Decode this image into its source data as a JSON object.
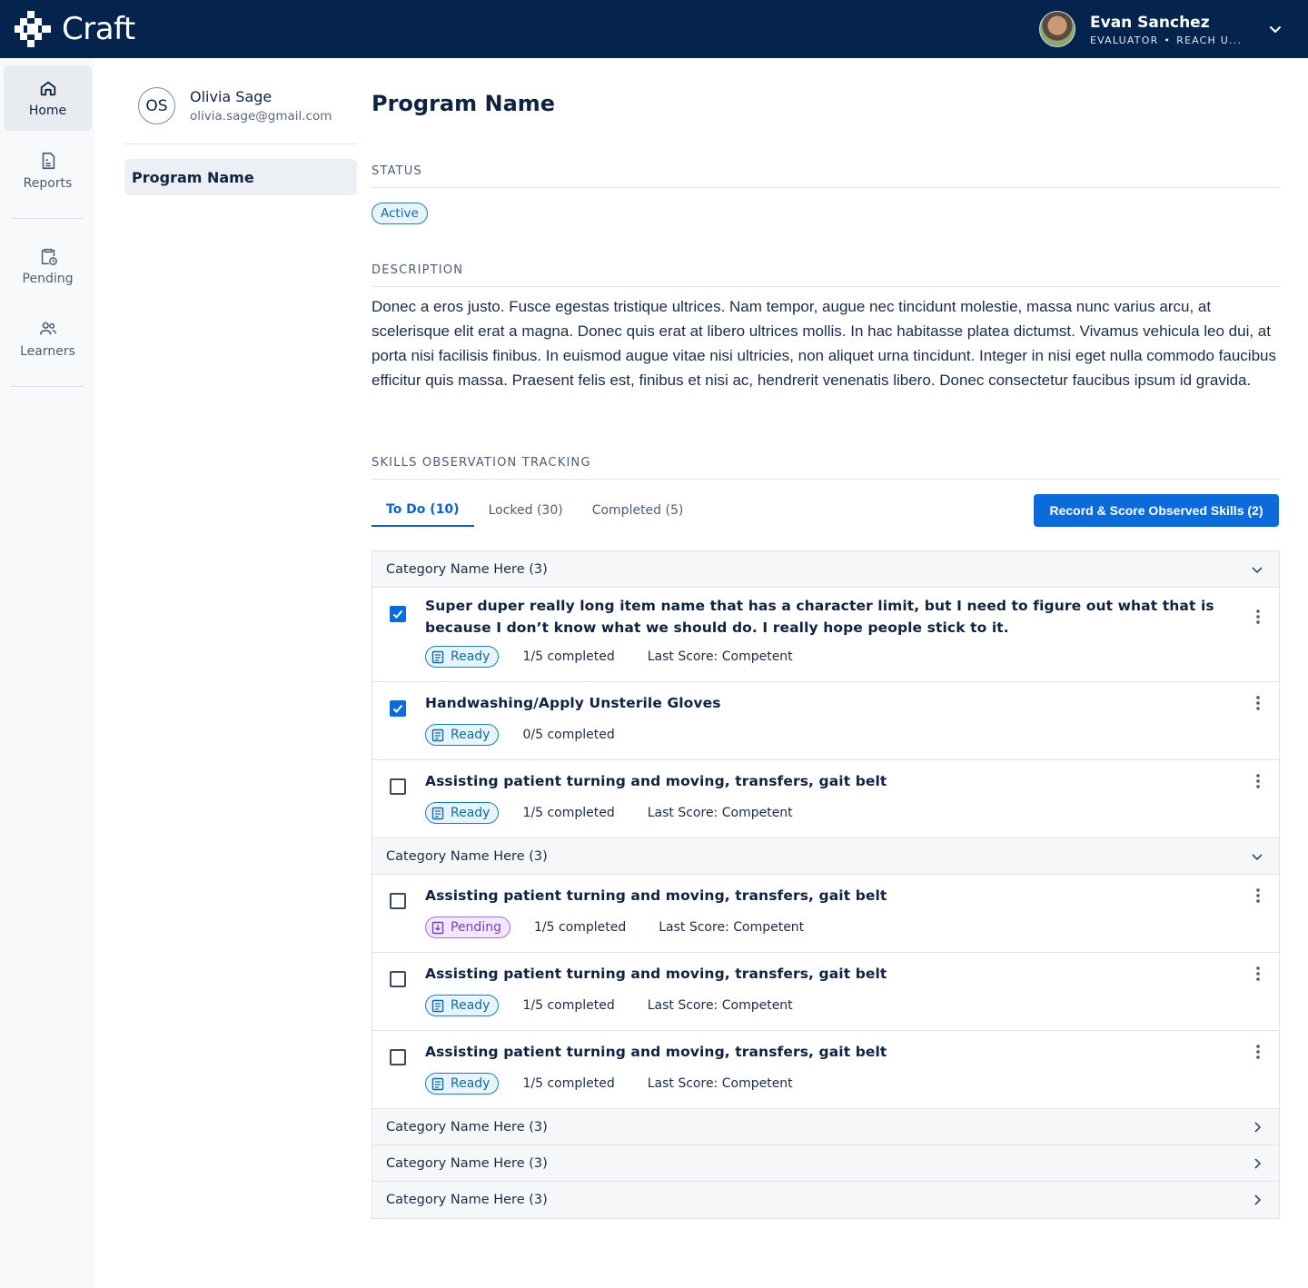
{
  "app": {
    "brand": "Craft"
  },
  "user": {
    "name": "Evan Sanchez",
    "role": "EVALUATOR",
    "org": "REACH U..."
  },
  "nav": [
    {
      "label": "Home",
      "icon": "home-icon",
      "active": true
    },
    {
      "label": "Reports",
      "icon": "reports-icon",
      "active": false
    },
    {
      "label": "Pending",
      "icon": "pending-clipboard-icon",
      "active": false
    },
    {
      "label": "Learners",
      "icon": "learners-icon",
      "active": false
    }
  ],
  "learner": {
    "initials": "OS",
    "name": "Olivia Sage",
    "email": "olivia.sage@gmail.com"
  },
  "sidebar_program": "Program Name",
  "page_title": "Program Name",
  "status": {
    "label": "STATUS",
    "value": "Active"
  },
  "description": {
    "label": "DESCRIPTION",
    "text": "Donec a eros justo. Fusce egestas tristique ultrices. Nam tempor, augue nec tincidunt molestie, massa nunc varius arcu, at scelerisque elit erat a magna. Donec quis erat at libero ultrices mollis. In hac habitasse platea dictumst. Vivamus vehicula leo dui, at porta nisi facilisis finibus. In euismod augue vitae nisi ultricies, non aliquet urna tincidunt. Integer in nisi eget nulla commodo faucibus efficitur quis massa. Praesent felis est, finibus et nisi ac, hendrerit venenatis libero. Donec consectetur faucibus ipsum id gravida."
  },
  "skills": {
    "label": "SKILLS OBSERVATION TRACKING",
    "tabs": [
      {
        "label": "To Do (10)",
        "active": true
      },
      {
        "label": "Locked (30)",
        "active": false
      },
      {
        "label": "Completed (5)",
        "active": false
      }
    ],
    "record_button": "Record & Score Observed Skills (2)",
    "categories": [
      {
        "name": "Category Name Here (3)",
        "expanded": true,
        "items": [
          {
            "title": "Super duper really long item name that has a character limit, but I need to figure out what that is because I don’t know what we should do. I really hope people stick to it.",
            "checked": true,
            "status": "Ready",
            "progress": "1/5 completed",
            "last_score": "Last Score: Competent"
          },
          {
            "title": "Handwashing/Apply Unsterile Gloves",
            "checked": true,
            "status": "Ready",
            "progress": "0/5 completed",
            "last_score": ""
          },
          {
            "title": "Assisting patient turning and moving, transfers, gait belt",
            "checked": false,
            "status": "Ready",
            "progress": "1/5 completed",
            "last_score": "Last Score: Competent"
          }
        ]
      },
      {
        "name": "Category Name Here (3)",
        "expanded": true,
        "items": [
          {
            "title": "Assisting patient turning and moving, transfers, gait belt",
            "checked": false,
            "status": "Pending",
            "progress": "1/5 completed",
            "last_score": "Last Score: Competent"
          },
          {
            "title": "Assisting patient turning and moving, transfers, gait belt",
            "checked": false,
            "status": "Ready",
            "progress": "1/5 completed",
            "last_score": "Last Score: Competent"
          },
          {
            "title": "Assisting patient turning and moving, transfers, gait belt",
            "checked": false,
            "status": "Ready",
            "progress": "1/5 completed",
            "last_score": "Last Score: Competent"
          }
        ]
      },
      {
        "name": "Category Name Here (3)",
        "expanded": false,
        "items": []
      },
      {
        "name": "Category Name Here (3)",
        "expanded": false,
        "items": []
      },
      {
        "name": "Category Name Here (3)",
        "expanded": false,
        "items": []
      }
    ]
  },
  "colors": {
    "topbar": "#04234d",
    "primary": "#0b6bdb",
    "ready": "#1b7fb3",
    "pending": "#a86bd9"
  }
}
